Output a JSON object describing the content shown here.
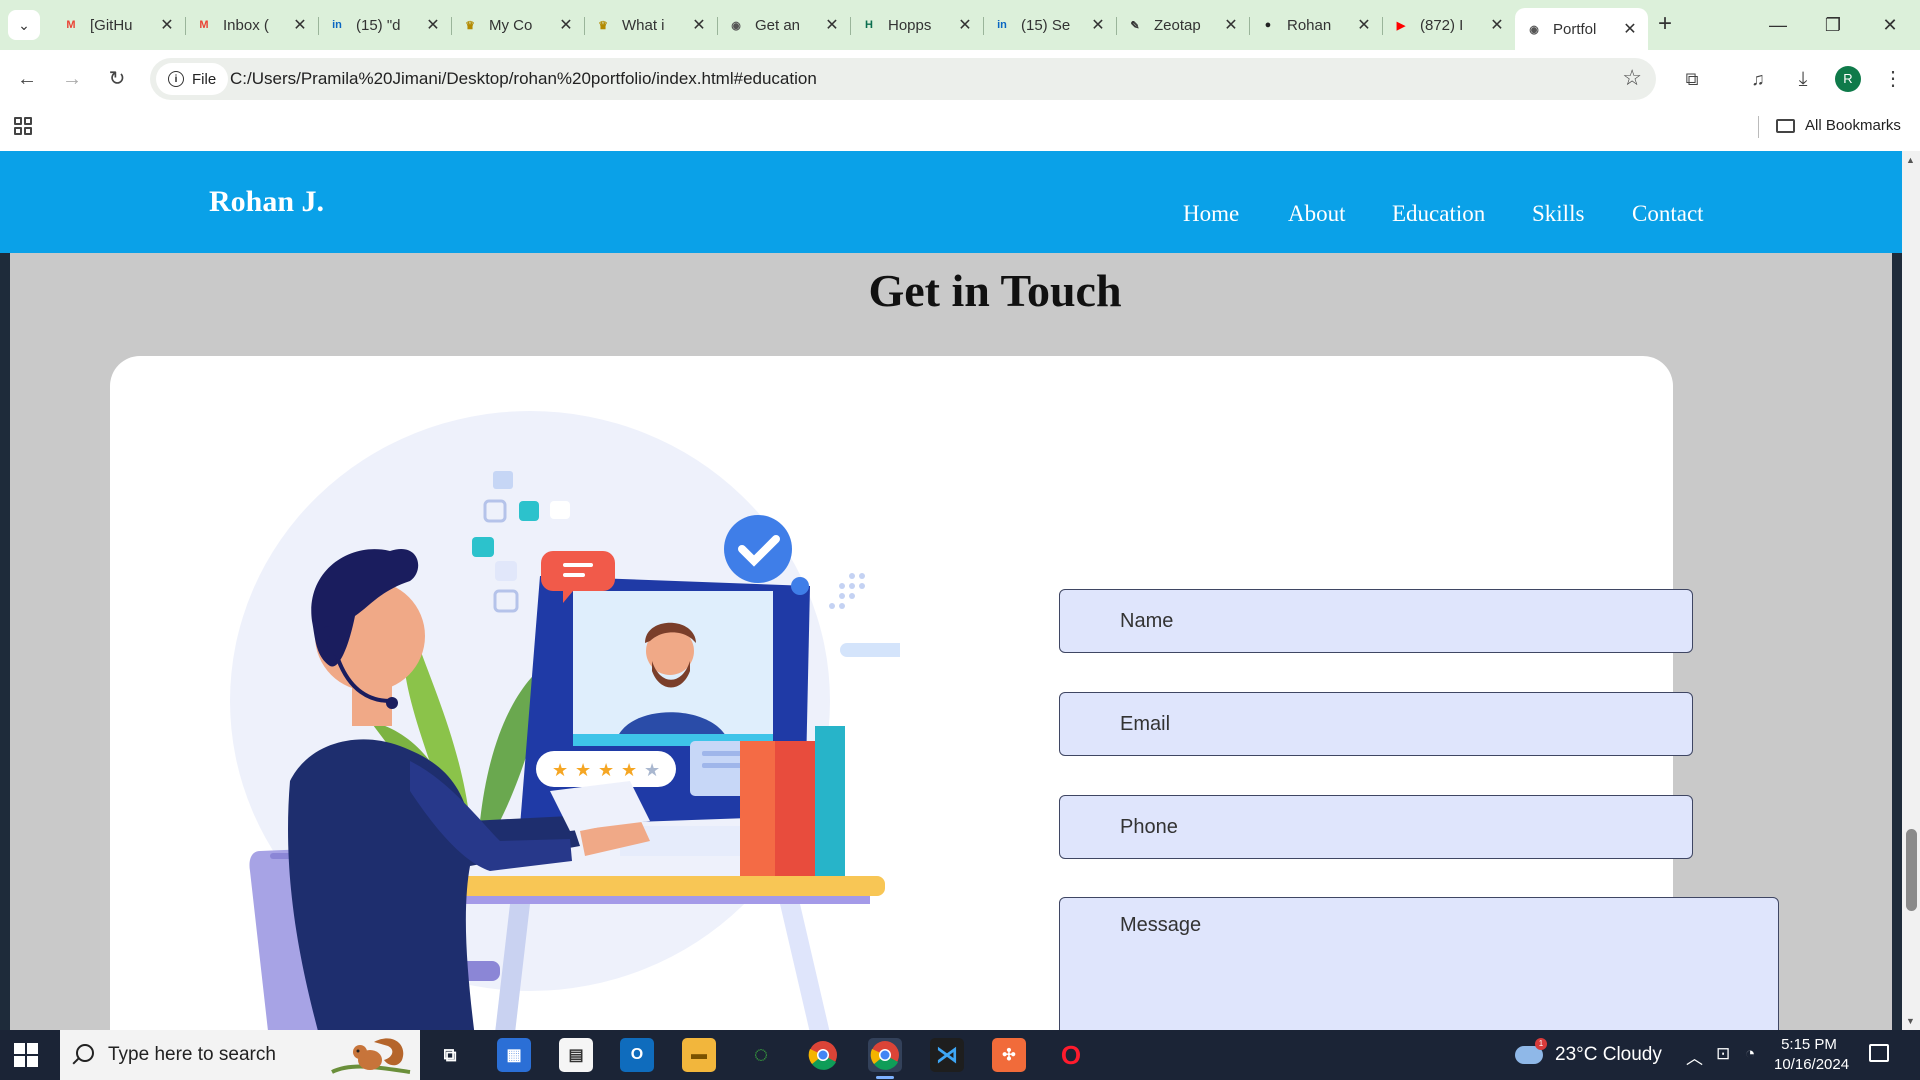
{
  "browser": {
    "tabs": [
      {
        "title": "[GitHu",
        "icon": "gmail-icon",
        "fav": "M",
        "favcolor": "#ea4335"
      },
      {
        "title": "Inbox (",
        "icon": "gmail-icon",
        "fav": "M",
        "favcolor": "#ea4335"
      },
      {
        "title": "(15) \"d",
        "icon": "linkedin-icon",
        "fav": "in",
        "favcolor": "#0a66c2"
      },
      {
        "title": "My Co",
        "icon": "crown-icon",
        "fav": "♛",
        "favcolor": "#b38a00"
      },
      {
        "title": "What i",
        "icon": "crown-icon",
        "fav": "♛",
        "favcolor": "#b38a00"
      },
      {
        "title": "Get an",
        "icon": "globe-icon",
        "fav": "◉",
        "favcolor": "#555555"
      },
      {
        "title": "Hopps",
        "icon": "hoppscotch-icon",
        "fav": "H",
        "favcolor": "#0b6e4f"
      },
      {
        "title": "(15) Se",
        "icon": "linkedin-icon",
        "fav": "in",
        "favcolor": "#0a66c2"
      },
      {
        "title": "Zeotap",
        "icon": "pen-icon",
        "fav": "✎",
        "favcolor": "#333333"
      },
      {
        "title": "Rohan",
        "icon": "github-icon",
        "fav": "●",
        "favcolor": "#222222"
      },
      {
        "title": "(872) I",
        "icon": "youtube-icon",
        "fav": "▶",
        "favcolor": "#ff0000"
      },
      {
        "title": "Portfol",
        "icon": "globe-icon",
        "fav": "◉",
        "favcolor": "#555555",
        "active": true
      }
    ],
    "url": "C:/Users/Pramila%20Jimani/Desktop/rohan%20portfolio/index.html#education",
    "chip_label": "File",
    "profile_initial": "R",
    "bookmarks_label": "All Bookmarks"
  },
  "page": {
    "brand": "Rohan J.",
    "nav": [
      "Home",
      "About",
      "Education",
      "Skills",
      "Contact"
    ],
    "section_title": "Get in Touch",
    "form": {
      "name_placeholder": "Name",
      "email_placeholder": "Email",
      "phone_placeholder": "Phone",
      "message_placeholder": "Message"
    },
    "colors": {
      "navbar": "#0aa1e8",
      "input_bg": "#dfe5fc",
      "page_bg": "#c9c9c9"
    }
  },
  "taskbar": {
    "search_placeholder": "Type here to search",
    "weather": "23°C  Cloudy",
    "weather_badge": "1",
    "time": "5:15 PM",
    "date": "10/16/2024"
  }
}
